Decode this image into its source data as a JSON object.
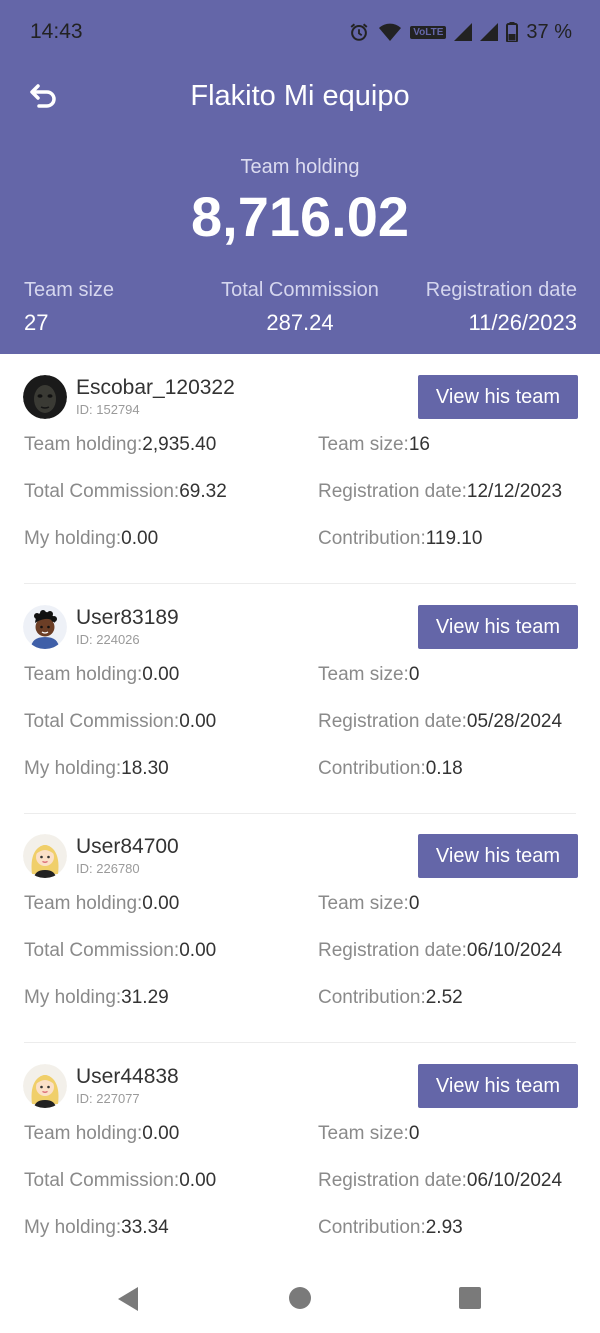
{
  "status_bar": {
    "time": "14:43",
    "network": "VoLTE",
    "battery": "37 %"
  },
  "header": {
    "title": "Flakito Mi equipo",
    "team_holding_label": "Team holding",
    "team_holding_value": "8,716.02",
    "stats": [
      {
        "label": "Team size",
        "value": "27"
      },
      {
        "label": "Total Commission",
        "value": "287.24"
      },
      {
        "label": "Registration date",
        "value": "11/26/2023"
      }
    ]
  },
  "labels": {
    "view_button": "View his team",
    "id_prefix": "ID:",
    "team_holding": "Team holding:",
    "team_size": "Team size:",
    "total_commission": "Total Commission:",
    "registration_date": "Registration date:",
    "my_holding": "My holding:",
    "contribution": "Contribution:"
  },
  "members": [
    {
      "name": "Escobar_120322",
      "id": "152794",
      "team_holding": "2,935.40",
      "team_size": "16",
      "total_commission": "69.32",
      "registration_date": "12/12/2023",
      "my_holding": "0.00",
      "contribution": "119.10",
      "avatar": "dark-photo-avatar"
    },
    {
      "name": "User83189",
      "id": "224026",
      "team_holding": "0.00",
      "team_size": "0",
      "total_commission": "0.00",
      "registration_date": "05/28/2024",
      "my_holding": "18.30",
      "contribution": "0.18",
      "avatar": "boy-cartoon-avatar"
    },
    {
      "name": "User84700",
      "id": "226780",
      "team_holding": "0.00",
      "team_size": "0",
      "total_commission": "0.00",
      "registration_date": "06/10/2024",
      "my_holding": "31.29",
      "contribution": "2.52",
      "avatar": "blonde-girl-cartoon-avatar"
    },
    {
      "name": "User44838",
      "id": "227077",
      "team_holding": "0.00",
      "team_size": "0",
      "total_commission": "0.00",
      "registration_date": "06/10/2024",
      "my_holding": "33.34",
      "contribution": "2.93",
      "avatar": "blonde-girl-cartoon-avatar"
    }
  ],
  "colors": {
    "accent": "#6466a8",
    "label": "#8a8a8a",
    "value": "#333333"
  }
}
